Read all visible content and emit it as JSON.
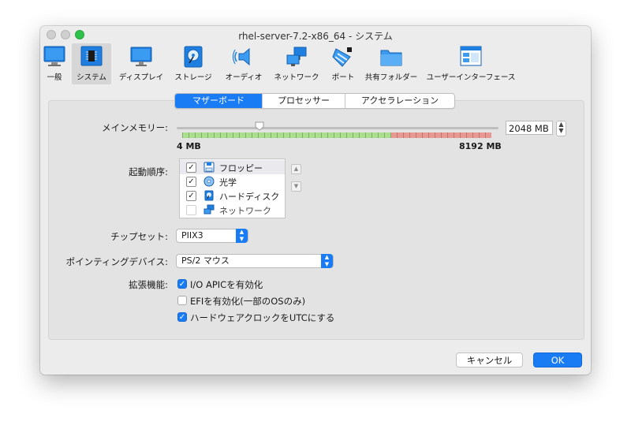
{
  "window": {
    "title": "rhel-server-7.2-x86_64 - システム"
  },
  "toolbar": {
    "items": [
      {
        "label": "一般",
        "icon": "monitor-icon"
      },
      {
        "label": "システム",
        "icon": "chip-icon",
        "active": true
      },
      {
        "label": "ディスプレイ",
        "icon": "display-icon"
      },
      {
        "label": "ストレージ",
        "icon": "harddisk-icon"
      },
      {
        "label": "オーディオ",
        "icon": "speaker-icon"
      },
      {
        "label": "ネットワーク",
        "icon": "network-icon"
      },
      {
        "label": "ポート",
        "icon": "port-icon"
      },
      {
        "label": "共有フォルダー",
        "icon": "folder-icon"
      },
      {
        "label": "ユーザーインターフェース",
        "icon": "window-ui-icon"
      }
    ]
  },
  "tabs": [
    {
      "label": "マザーボード",
      "active": true
    },
    {
      "label": "プロセッサー",
      "active": false
    },
    {
      "label": "アクセラレーション",
      "active": false
    }
  ],
  "memory": {
    "label": "メインメモリー:",
    "value": "2048 MB",
    "min_label": "4 MB",
    "max_label": "8192 MB",
    "min_mb": 4,
    "max_mb": 8192,
    "current_mb": 2048,
    "green_until_mb": 5530,
    "colors": {
      "safe": "#a8de8c",
      "danger": "#e89a92"
    }
  },
  "boot": {
    "label": "起動順序:",
    "items": [
      {
        "label": "フロッピー",
        "checked": true,
        "icon": "floppy-icon"
      },
      {
        "label": "光学",
        "checked": true,
        "icon": "optical-disc-icon"
      },
      {
        "label": "ハードディスク",
        "checked": true,
        "icon": "harddisk-icon"
      },
      {
        "label": "ネットワーク",
        "checked": false,
        "icon": "network-icon"
      }
    ]
  },
  "chipset": {
    "label": "チップセット:",
    "value": "PIIX3"
  },
  "pointing": {
    "label": "ポインティングデバイス:",
    "value": "PS/2 マウス"
  },
  "features": {
    "label": "拡張機能:",
    "items": [
      {
        "label": "I/O APICを有効化",
        "checked": true
      },
      {
        "label": "EFIを有効化(一部のOSのみ)",
        "checked": false
      },
      {
        "label": "ハードウェアクロックをUTCにする",
        "checked": true
      }
    ]
  },
  "buttons": {
    "cancel": "キャンセル",
    "ok": "OK"
  },
  "colors": {
    "accent": "#1a7cf4"
  }
}
